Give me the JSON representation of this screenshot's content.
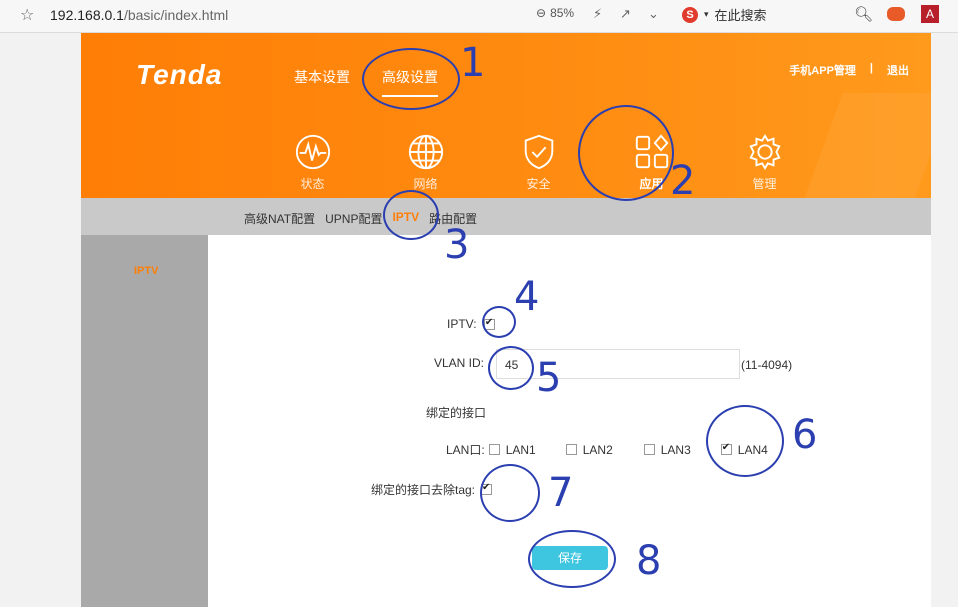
{
  "browser": {
    "url_main": "192.168.0.1",
    "url_rest": "/basic/index.html",
    "zoom": "85%",
    "search_engine_letter": "S",
    "search_placeholder": "在此搜索"
  },
  "header": {
    "logo": "Tenda",
    "nav": [
      "基本设置",
      "高级设置"
    ],
    "active_nav": "高级设置",
    "top_right": [
      "手机APP管理",
      "|",
      "退出"
    ]
  },
  "icons": [
    {
      "label": "状态",
      "icon": "pulse-icon"
    },
    {
      "label": "网络",
      "icon": "globe-icon"
    },
    {
      "label": "安全",
      "icon": "shield-icon"
    },
    {
      "label": "应用",
      "icon": "apps-icon",
      "active": true
    },
    {
      "label": "管理",
      "icon": "gear-icon"
    }
  ],
  "subnav": [
    "高级NAT配置",
    "UPNP配置",
    "IPTV",
    "路由配置"
  ],
  "sidebar": {
    "item": "IPTV"
  },
  "form": {
    "iptv_label": "IPTV:",
    "iptv_checked": true,
    "vlan_label": "VLAN ID:",
    "vlan_value": "45",
    "vlan_range": "(11-4094)",
    "bound_title": "绑定的接口",
    "lan_label": "LAN口:",
    "lan_ports": [
      {
        "name": "LAN1",
        "checked": false
      },
      {
        "name": "LAN2",
        "checked": false
      },
      {
        "name": "LAN3",
        "checked": false
      },
      {
        "name": "LAN4",
        "checked": true
      }
    ],
    "untag_label": "绑定的接口去除tag:",
    "untag_checked": true,
    "save_label": "保存"
  },
  "annotations": [
    "1",
    "2",
    "3",
    "4",
    "5",
    "6",
    "7",
    "8"
  ],
  "colors": {
    "brand_orange": "#ff7e06",
    "save_button": "#3ec6e0",
    "annotation_blue": "#2b3fb0",
    "subnav_gray": "#c9c9c9",
    "sidebar_gray": "#a9a9a9"
  }
}
